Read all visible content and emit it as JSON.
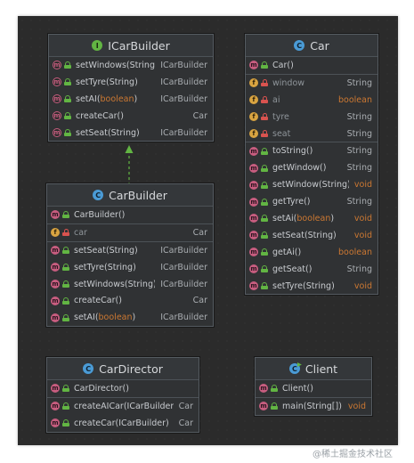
{
  "classes": {
    "icarbuilder": {
      "title": "ICarBuilder",
      "kind": "I",
      "fields": [],
      "methods": [
        {
          "name": "setWindows(String)",
          "type": "ICarBuilder",
          "abstract": true
        },
        {
          "name": "setTyre(String)",
          "type": "ICarBuilder",
          "abstract": true
        },
        {
          "name": "setAI(boolean)",
          "type": "ICarBuilder",
          "abstract": true
        },
        {
          "name": "createCar()",
          "type": "Car",
          "abstract": true
        },
        {
          "name": "setSeat(String)",
          "type": "ICarBuilder",
          "abstract": true
        }
      ]
    },
    "car": {
      "title": "Car",
      "kind": "C",
      "constructors": [
        {
          "name": "Car()",
          "type": ""
        }
      ],
      "fields": [
        {
          "name": "window",
          "type": "String"
        },
        {
          "name": "ai",
          "type": "boolean"
        },
        {
          "name": "tyre",
          "type": "String"
        },
        {
          "name": "seat",
          "type": "String"
        }
      ],
      "methods": [
        {
          "name": "toString()",
          "type": "String"
        },
        {
          "name": "getWindow()",
          "type": "String"
        },
        {
          "name": "setWindow(String)",
          "type": "void"
        },
        {
          "name": "getTyre()",
          "type": "String"
        },
        {
          "name": "setAi(boolean)",
          "type": "void"
        },
        {
          "name": "setSeat(String)",
          "type": "void"
        },
        {
          "name": "getAi()",
          "type": "boolean"
        },
        {
          "name": "getSeat()",
          "type": "String"
        },
        {
          "name": "setTyre(String)",
          "type": "void"
        }
      ]
    },
    "carbuilder": {
      "title": "CarBuilder",
      "kind": "C",
      "constructors": [
        {
          "name": "CarBuilder()",
          "type": ""
        }
      ],
      "fields": [
        {
          "name": "car",
          "type": "Car"
        }
      ],
      "methods": [
        {
          "name": "setSeat(String)",
          "type": "ICarBuilder"
        },
        {
          "name": "setTyre(String)",
          "type": "ICarBuilder"
        },
        {
          "name": "setWindows(String)",
          "type": "ICarBuilder"
        },
        {
          "name": "createCar()",
          "type": "Car"
        },
        {
          "name": "setAI(boolean)",
          "type": "ICarBuilder"
        }
      ]
    },
    "cardirector": {
      "title": "CarDirector",
      "kind": "C",
      "constructors": [
        {
          "name": "CarDirector()",
          "type": ""
        }
      ],
      "fields": [],
      "methods": [
        {
          "name": "createAICar(ICarBuilder)",
          "type": "Car"
        },
        {
          "name": "createCar(ICarBuilder)",
          "type": "Car"
        }
      ]
    },
    "client": {
      "title": "Client",
      "kind": "C",
      "constructors": [
        {
          "name": "Client()",
          "type": ""
        }
      ],
      "fields": [],
      "methods": [
        {
          "name": "main(String[])",
          "type": "void"
        }
      ]
    }
  },
  "colors": {
    "canvas": "#2b2b2b",
    "method_icon": "#c75d7f",
    "field_icon": "#d9a441",
    "interface_badge": "#62b543",
    "class_badge": "#4a9bd6",
    "keyword": "#cc7832",
    "edge": "#62b543"
  },
  "watermark": "@稀土掘金技术社区"
}
